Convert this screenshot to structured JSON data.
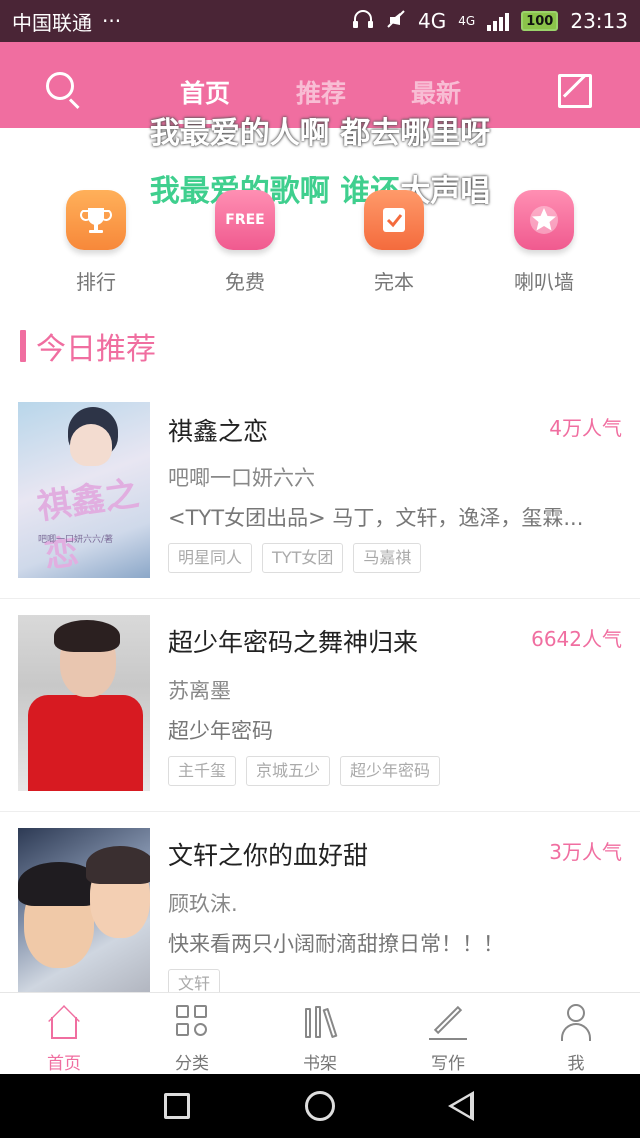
{
  "status_bar": {
    "carrier": "中国联通",
    "dots": "···",
    "network1": "4G",
    "network2": "4G",
    "battery": "100",
    "time": "23:13"
  },
  "header": {
    "tabs": [
      {
        "label": "首页",
        "active": true
      },
      {
        "label": "推荐",
        "active": false
      },
      {
        "label": "最新",
        "active": false
      }
    ],
    "search_icon": "search-icon",
    "edit_icon": "edit-icon"
  },
  "lyrics": {
    "line1": "我最爱的人啊 都去哪里呀",
    "line2_highlight": "我最爱的歌啊 谁还",
    "line2_rest": "大声唱"
  },
  "quick_menu": [
    {
      "label": "排行",
      "icon": "trophy-icon"
    },
    {
      "label": "免费",
      "icon": "free-icon",
      "icon_text": "FREE"
    },
    {
      "label": "完本",
      "icon": "check-book-icon"
    },
    {
      "label": "喇叭墙",
      "icon": "star-icon"
    }
  ],
  "section": {
    "title": "今日推荐"
  },
  "books": [
    {
      "title": "祺鑫之恋",
      "popularity": "4万人气",
      "author": "吧唧一口妍六六",
      "description": "<TYT女团出品> 马丁，文轩，逸泽，玺霖...",
      "tags": [
        "明星同人",
        "TYT女团",
        "马嘉祺"
      ],
      "cover_text": "祺鑫之恋",
      "cover_sub": "吧唧一口妍六六/著"
    },
    {
      "title": "超少年密码之舞神归来",
      "popularity": "6642人气",
      "author": "苏离墨",
      "description": "超少年密码",
      "tags": [
        "主千玺",
        "京城五少",
        "超少年密码"
      ]
    },
    {
      "title": "文轩之你的血好甜",
      "popularity": "3万人气",
      "author": "顾玖沫.",
      "description": "快来看两只小阔耐滴甜撩日常！！！",
      "tags": [
        "文轩"
      ]
    }
  ],
  "bottom_nav": [
    {
      "label": "首页",
      "icon": "home-icon",
      "active": true
    },
    {
      "label": "分类",
      "icon": "category-icon",
      "active": false
    },
    {
      "label": "书架",
      "icon": "bookshelf-icon",
      "active": false
    },
    {
      "label": "写作",
      "icon": "write-icon",
      "active": false
    },
    {
      "label": "我",
      "icon": "profile-icon",
      "active": false
    }
  ],
  "colors": {
    "accent": "#f06ea0",
    "status_bar": "#4a2536"
  }
}
